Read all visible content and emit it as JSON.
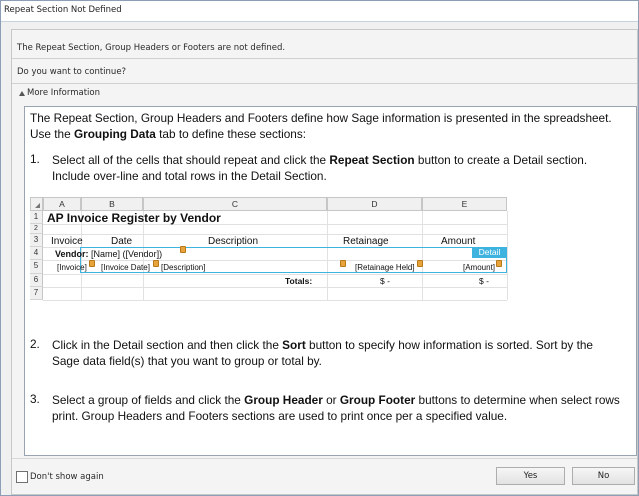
{
  "window": {
    "title": "Repeat Section Not Defined"
  },
  "message": {
    "line1": "The Repeat Section, Group Headers or Footers are not defined.",
    "line2": "Do you want to continue?",
    "more_info_label": "More Information"
  },
  "info": {
    "intro1_a": "The Repeat Section, Group Headers and Footers define how Sage information is presented in the spreadsheet.",
    "intro2_a": "Use the ",
    "intro2_b": "Grouping Data",
    "intro2_c": " tab to define these sections:",
    "step1_num": "1.",
    "step1_a": "Select all of the cells that should repeat and click the ",
    "step1_b": "Repeat Section",
    "step1_c": " button to create a Detail section.",
    "step1_d": "Include over-line and total rows in the Detail Section.",
    "step2_num": "2.",
    "step2_a": "Click in the Detail section and then click the ",
    "step2_b": "Sort",
    "step2_c": " button to specify how information is sorted. Sort by the",
    "step2_d": "Sage data field(s) that you want to group or total by.",
    "step3_num": "3.",
    "step3_a": "Select a group of fields and click the ",
    "step3_b": "Group Header",
    "step3_c": " or ",
    "step3_d": "Group Footer",
    "step3_e": " buttons to determine when select rows",
    "step3_f": "print. Group Headers and Footers sections are used to print once per a specified value."
  },
  "sheet": {
    "columns": [
      "A",
      "B",
      "C",
      "D",
      "E"
    ],
    "rows": [
      "1",
      "2",
      "3",
      "4",
      "5",
      "6",
      "7"
    ],
    "title": "AP Invoice Register by Vendor",
    "headers": {
      "invoice": "Invoice",
      "date": "Date",
      "description": "Description",
      "retainage": "Retainage",
      "amount": "Amount"
    },
    "vendor_label": "Vendor:",
    "vendor_value": "[Name] ([Vendor])",
    "detail_label": "Detail",
    "row5": {
      "invoice": "[Invoice]",
      "date": "[Invoice Date]",
      "description": "[Description]",
      "retainage": "[Retainage Held]",
      "amount": "[Amount]"
    },
    "totals_label": "Totals:",
    "totals_retainage": "$ -",
    "totals_amount": "$ -",
    "accent_color": "#3fb3e0"
  },
  "footer": {
    "dont_show_label": "Don't show again",
    "yes_label": "Yes",
    "no_label": "No"
  }
}
